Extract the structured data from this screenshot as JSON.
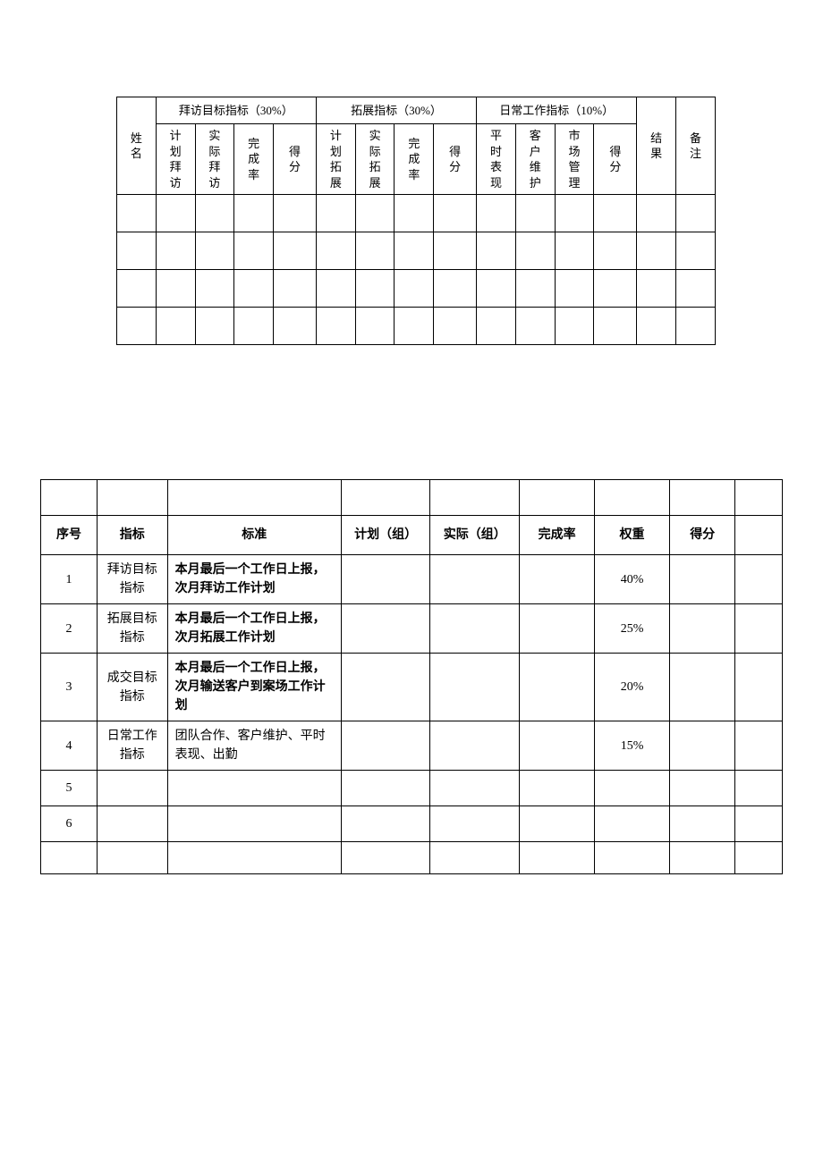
{
  "table1": {
    "group_headers": {
      "name": "姓名",
      "visit": "拜访目标指标（30%）",
      "expand": "拓展指标（30%）",
      "daily": "日常工作指标（10%）",
      "result": "结果",
      "remark": "备注"
    },
    "sub_headers": {
      "visit_plan": "计划拜访",
      "visit_actual": "实际拜访",
      "visit_rate": "完成率",
      "visit_score": "得分",
      "expand_plan": "计划拓展",
      "expand_actual": "实际拓展",
      "expand_rate": "完成率",
      "expand_score": "得分",
      "daily_perf": "平时表现",
      "daily_cust": "客户维护",
      "daily_market": "市场管理",
      "daily_score": "得分"
    }
  },
  "table2": {
    "headers": {
      "no": "序号",
      "indicator": "指标",
      "standard": "标准",
      "plan": "计划（组）",
      "actual": "实际（组）",
      "rate": "完成率",
      "weight": "权重",
      "score": "得分",
      "blank": ""
    },
    "rows": [
      {
        "no": "1",
        "indicator": "拜访目标指标",
        "standard": "本月最后一个工作日上报，次月拜访工作计划",
        "standard_bold": true,
        "weight": "40%"
      },
      {
        "no": "2",
        "indicator": "拓展目标指标",
        "standard": "本月最后一个工作日上报，次月拓展工作计划",
        "standard_bold": true,
        "weight": "25%"
      },
      {
        "no": "3",
        "indicator": "成交目标指标",
        "standard": "本月最后一个工作日上报，次月输送客户到案场工作计划",
        "standard_bold": true,
        "weight": "20%"
      },
      {
        "no": "4",
        "indicator": "日常工作指标",
        "standard": "团队合作、客户维护、平时表现、出勤",
        "standard_bold": false,
        "weight": "15%"
      },
      {
        "no": "5",
        "indicator": "",
        "standard": "",
        "standard_bold": false,
        "weight": ""
      },
      {
        "no": "6",
        "indicator": "",
        "standard": "",
        "standard_bold": false,
        "weight": ""
      }
    ]
  }
}
